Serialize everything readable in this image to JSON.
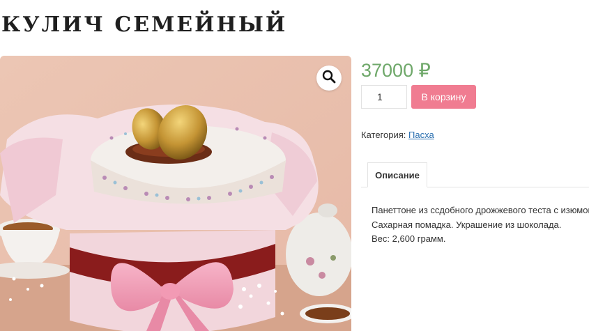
{
  "product": {
    "title": "КУЛИЧ СЕМЕЙНЫЙ",
    "price": "37000 ₽",
    "quantity": "1",
    "add_to_cart_label": "В корзину",
    "category_label": "Категория:",
    "category_link": "Пасха"
  },
  "tabs": [
    {
      "label": "Описание",
      "active": true
    }
  ],
  "description": {
    "lines": [
      "Панеттоне из ссдобного дрожжевого теста с изюмом",
      "Сахарная помадка. Украшение из шоколада.",
      "Вес: 2,600 грамм."
    ]
  },
  "image": {
    "zoom_icon": "magnifier-icon",
    "alt": ""
  },
  "colors": {
    "price": "#6fa86a",
    "button": "#f07c91",
    "link": "#2a6fb0"
  }
}
